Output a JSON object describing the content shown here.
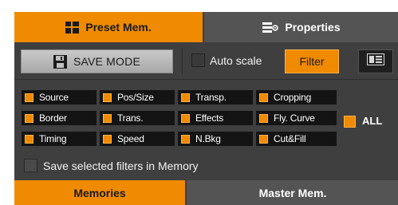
{
  "tabs": {
    "preset": {
      "label": "Preset Mem.",
      "icon": "grid-blocks-icon"
    },
    "properties": {
      "label": "Properties",
      "icon": "properties-icon"
    }
  },
  "toolbar": {
    "save_mode": {
      "label": "SAVE MODE",
      "icon": "floppy-disk-icon"
    },
    "auto_scale": {
      "label": "Auto scale",
      "checked": false
    },
    "filter": {
      "label": "Filter"
    },
    "list_view_icon": "list-view-icon"
  },
  "filters": [
    {
      "label": "Source",
      "checked": true
    },
    {
      "label": "Pos/Size",
      "checked": true
    },
    {
      "label": "Transp.",
      "checked": true
    },
    {
      "label": "Cropping",
      "checked": true
    },
    {
      "label": "Border",
      "checked": true
    },
    {
      "label": "Trans.",
      "checked": true
    },
    {
      "label": "Effects",
      "checked": true
    },
    {
      "label": "Fly. Curve",
      "checked": true
    },
    {
      "label": "Timing",
      "checked": true
    },
    {
      "label": "Speed",
      "checked": true
    },
    {
      "label": "N.Bkg",
      "checked": true
    },
    {
      "label": "Cut&Fill",
      "checked": true
    }
  ],
  "all_toggle": {
    "label": "ALL",
    "checked": true
  },
  "save_filters": {
    "label": "Save selected filters in Memory",
    "checked": false
  },
  "bottom_tabs": {
    "memories": {
      "label": "Memories"
    },
    "master": {
      "label": "Master Mem."
    }
  },
  "colors": {
    "accent": "#f08a00",
    "panel": "#3f3f3f",
    "tab_inactive": "#545454"
  }
}
